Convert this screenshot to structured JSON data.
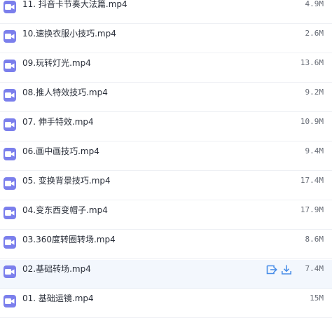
{
  "files": [
    {
      "name": "11. 抖音卡节奏大法篇.mp4",
      "size": "4.9M",
      "icon": "video-file-icon"
    },
    {
      "name": "10.速换衣服小技巧.mp4",
      "size": "2.6M",
      "icon": "video-file-icon"
    },
    {
      "name": "09.玩转灯光.mp4",
      "size": "13.6M",
      "icon": "video-file-icon"
    },
    {
      "name": "08.推人特效技巧.mp4",
      "size": "9.2M",
      "icon": "video-file-icon"
    },
    {
      "name": "07. 伸手特效.mp4",
      "size": "10.9M",
      "icon": "video-file-icon"
    },
    {
      "name": "06.画中画技巧.mp4",
      "size": "9.4M",
      "icon": "video-file-icon"
    },
    {
      "name": "05. 变换背景技巧.mp4",
      "size": "17.4M",
      "icon": "video-file-icon"
    },
    {
      "name": "04.变东西变帽子.mp4",
      "size": "17.9M",
      "icon": "video-file-icon"
    },
    {
      "name": "03.360度转圈转场.mp4",
      "size": "8.6M",
      "icon": "video-file-icon"
    },
    {
      "name": "02.基础转场.mp4",
      "size": "7.4M",
      "icon": "video-file-icon",
      "hovered": true,
      "actions": [
        "share-icon",
        "download-icon"
      ]
    },
    {
      "name": "01. 基础运镜.mp4",
      "size": "15M",
      "icon": "video-file-icon"
    }
  ],
  "colors": {
    "icon_bg": "#7b7fec",
    "action": "#4a8ee8",
    "hover_row_bg": "#f3f7fd",
    "text": "#2a2f3a",
    "size_text": "#666b75"
  }
}
